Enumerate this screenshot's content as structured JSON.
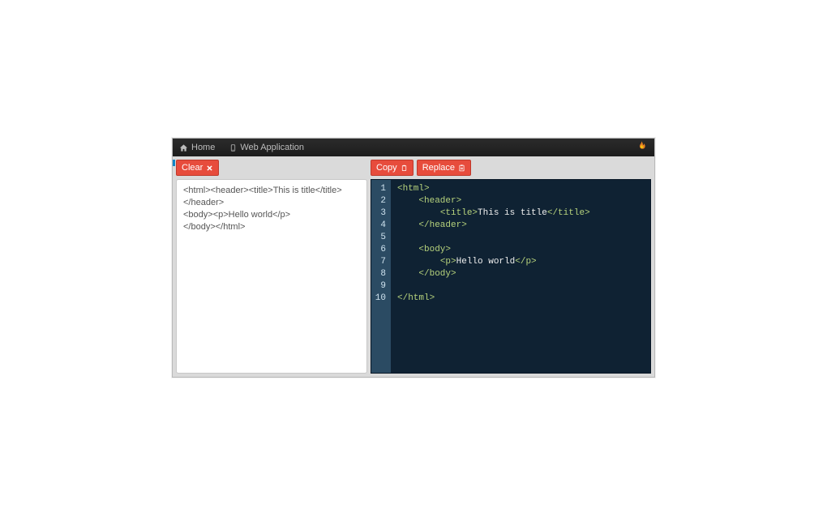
{
  "nav": {
    "home_label": "Home",
    "webapp_label": "Web Application"
  },
  "left_pane": {
    "clear_label": "Clear",
    "input_lines": [
      "<html><header><title>This is title</title>",
      "</header>",
      "<body><p>Hello world</p>",
      "</body></html>"
    ]
  },
  "right_pane": {
    "copy_label": "Copy",
    "replace_label": "Replace",
    "code": {
      "line_numbers": [
        "1",
        "2",
        "3",
        "4",
        "5",
        "6",
        "7",
        "8",
        "9",
        "10"
      ],
      "lines": [
        {
          "indent": 0,
          "tag": "<html>",
          "text": ""
        },
        {
          "indent": 1,
          "tag": "<header>",
          "text": ""
        },
        {
          "indent": 2,
          "tag_open": "<title>",
          "text": "This is title",
          "tag_close": "</title>"
        },
        {
          "indent": 1,
          "tag": "</header>",
          "text": ""
        },
        {
          "indent": 0,
          "tag": "",
          "text": ""
        },
        {
          "indent": 1,
          "tag": "<body>",
          "text": ""
        },
        {
          "indent": 2,
          "tag_open": "<p>",
          "text": "Hello world",
          "tag_close": "</p>"
        },
        {
          "indent": 1,
          "tag": "</body>",
          "text": ""
        },
        {
          "indent": 0,
          "tag": "",
          "text": ""
        },
        {
          "indent": 0,
          "tag": "</html>",
          "text": ""
        }
      ]
    }
  }
}
